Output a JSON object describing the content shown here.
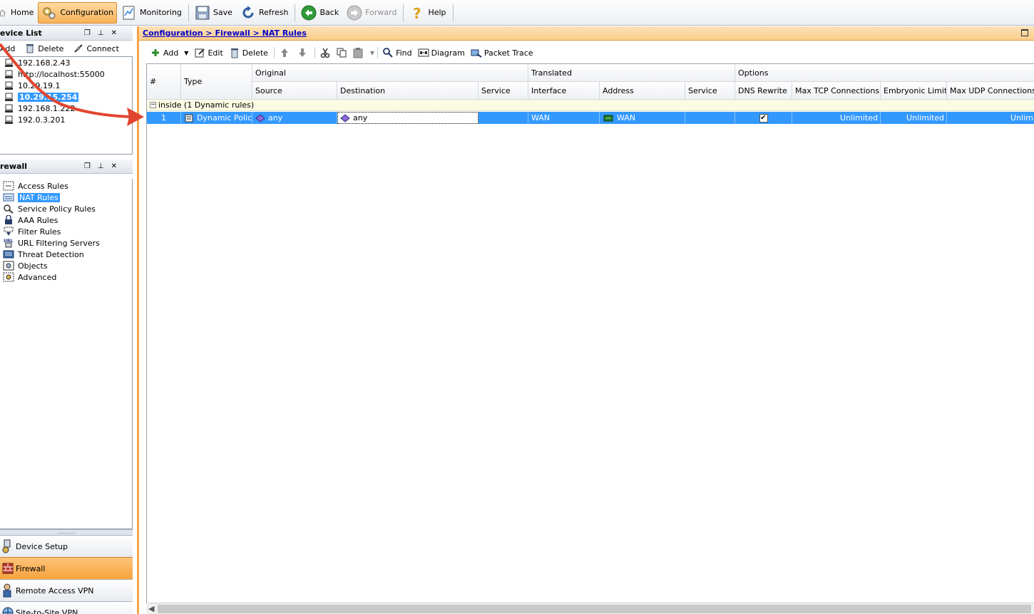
{
  "toolbar": {
    "home": "Home",
    "configuration": "Configuration",
    "monitoring": "Monitoring",
    "save": "Save",
    "refresh": "Refresh",
    "back": "Back",
    "forward": "Forward",
    "help": "Help"
  },
  "device_list": {
    "title": "evice List",
    "add": "Add",
    "delete": "Delete",
    "connect": "Connect",
    "items": [
      "192.168.2.43",
      "http://localhost:55000",
      "10.29.19.1",
      "10.29.15.254",
      "192.168.1.222",
      "192.0.3.201"
    ],
    "selected_index": 3
  },
  "firewall_panel": {
    "title": "rewall",
    "items": [
      "Access Rules",
      "NAT Rules",
      "Service Policy Rules",
      "AAA Rules",
      "Filter Rules",
      "URL Filtering Servers",
      "Threat Detection",
      "Objects",
      "Advanced"
    ],
    "selected_index": 1
  },
  "nav": {
    "grip": "..........",
    "device_setup": "Device Setup",
    "firewall": "Firewall",
    "remote_access_vpn": "Remote Access VPN",
    "site_to_site_vpn": "Site-to-Site VPN"
  },
  "breadcrumb": "Configuration > Firewall > NAT Rules",
  "nat_toolbar": {
    "add": "Add",
    "edit": "Edit",
    "delete": "Delete",
    "find": "Find",
    "diagram": "Diagram",
    "packet_trace": "Packet Trace"
  },
  "table": {
    "groups": {
      "original": "Original",
      "translated": "Translated",
      "options": "Options"
    },
    "columns": {
      "num": "#",
      "type": "Type",
      "source": "Source",
      "destination": "Destination",
      "service": "Service",
      "interface": "Interface",
      "address": "Address",
      "t_service": "Service",
      "dns_rewrite": "DNS Rewrite",
      "max_tcp": "Max TCP Connections",
      "embryonic": "Embryonic Limit",
      "max_udp": "Max UDP Connections"
    },
    "group_row": "inside (1 Dynamic rules)",
    "rows": [
      {
        "num": "1",
        "type": "Dynamic Policy",
        "source": "any",
        "destination": "any",
        "service": "",
        "interface": "WAN",
        "address": "WAN",
        "t_service": "",
        "dns_rewrite_checked": true,
        "max_tcp": "Unlimited",
        "embryonic": "Unlimited",
        "max_udp": "Unlimited"
      }
    ]
  },
  "colors": {
    "selection": "#3399ff",
    "accent_orange": "#f5a546",
    "annotation_arrow": "#e2452f"
  }
}
